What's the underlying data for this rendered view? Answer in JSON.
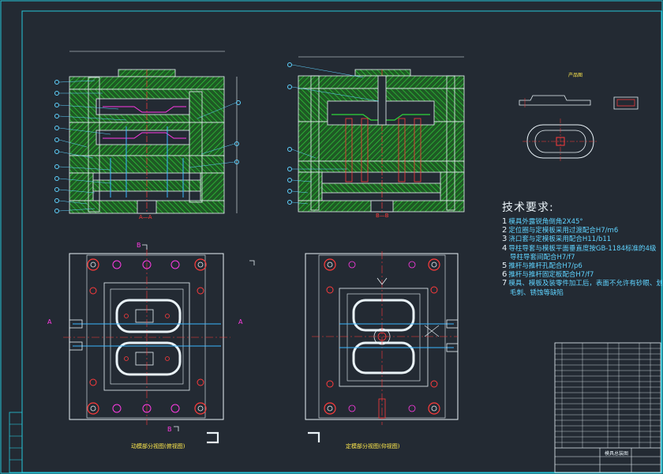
{
  "tech_requirements": {
    "title": "技术要求:",
    "items": [
      {
        "num": "1",
        "text": "模具外露锐角倒角2X45°"
      },
      {
        "num": "2",
        "text": "定位圈与定模板采用过渡配合H7/m6"
      },
      {
        "num": "3",
        "text": "浇口套与定模板采用配合H11/b11"
      },
      {
        "num": "4",
        "text": "导柱导套与模板平面垂直度按GB-1184标准的4级"
      },
      {
        "num": "",
        "text": "导柱导套间配合H7/f7"
      },
      {
        "num": "5",
        "text": "推杆与推杆孔配合H7/p6"
      },
      {
        "num": "6",
        "text": "推杆与推杆固定板配合H7/f7"
      },
      {
        "num": "7",
        "text": "模具、模板及装零件加工后，表面不允许有砂眼、划痕、裂纹、"
      },
      {
        "num": "",
        "text": "毛刺、锈蚀等缺陷"
      }
    ]
  },
  "section_labels": {
    "a_a": "A—A",
    "b_b": "B—B",
    "a_left": "A",
    "a_right": "A",
    "b_top": "B",
    "b_bottom": "B"
  },
  "view_captions": {
    "moving_half": "动模部分视图(俯视图)",
    "fixed_half": "定模部分视图(仰视图)"
  },
  "part_label": "产品图",
  "title_block": {
    "drawing_name": "模具总装图"
  },
  "colors": {
    "background": "#232a33",
    "frame": "#26c7d9",
    "outline": "#e9f2f7",
    "hatch": "#2fd63a",
    "cyan_lines": "#3ab6ff",
    "magenta": "#ff3be4",
    "red": "#ff3b3b",
    "yellow": "#ffe94d"
  }
}
